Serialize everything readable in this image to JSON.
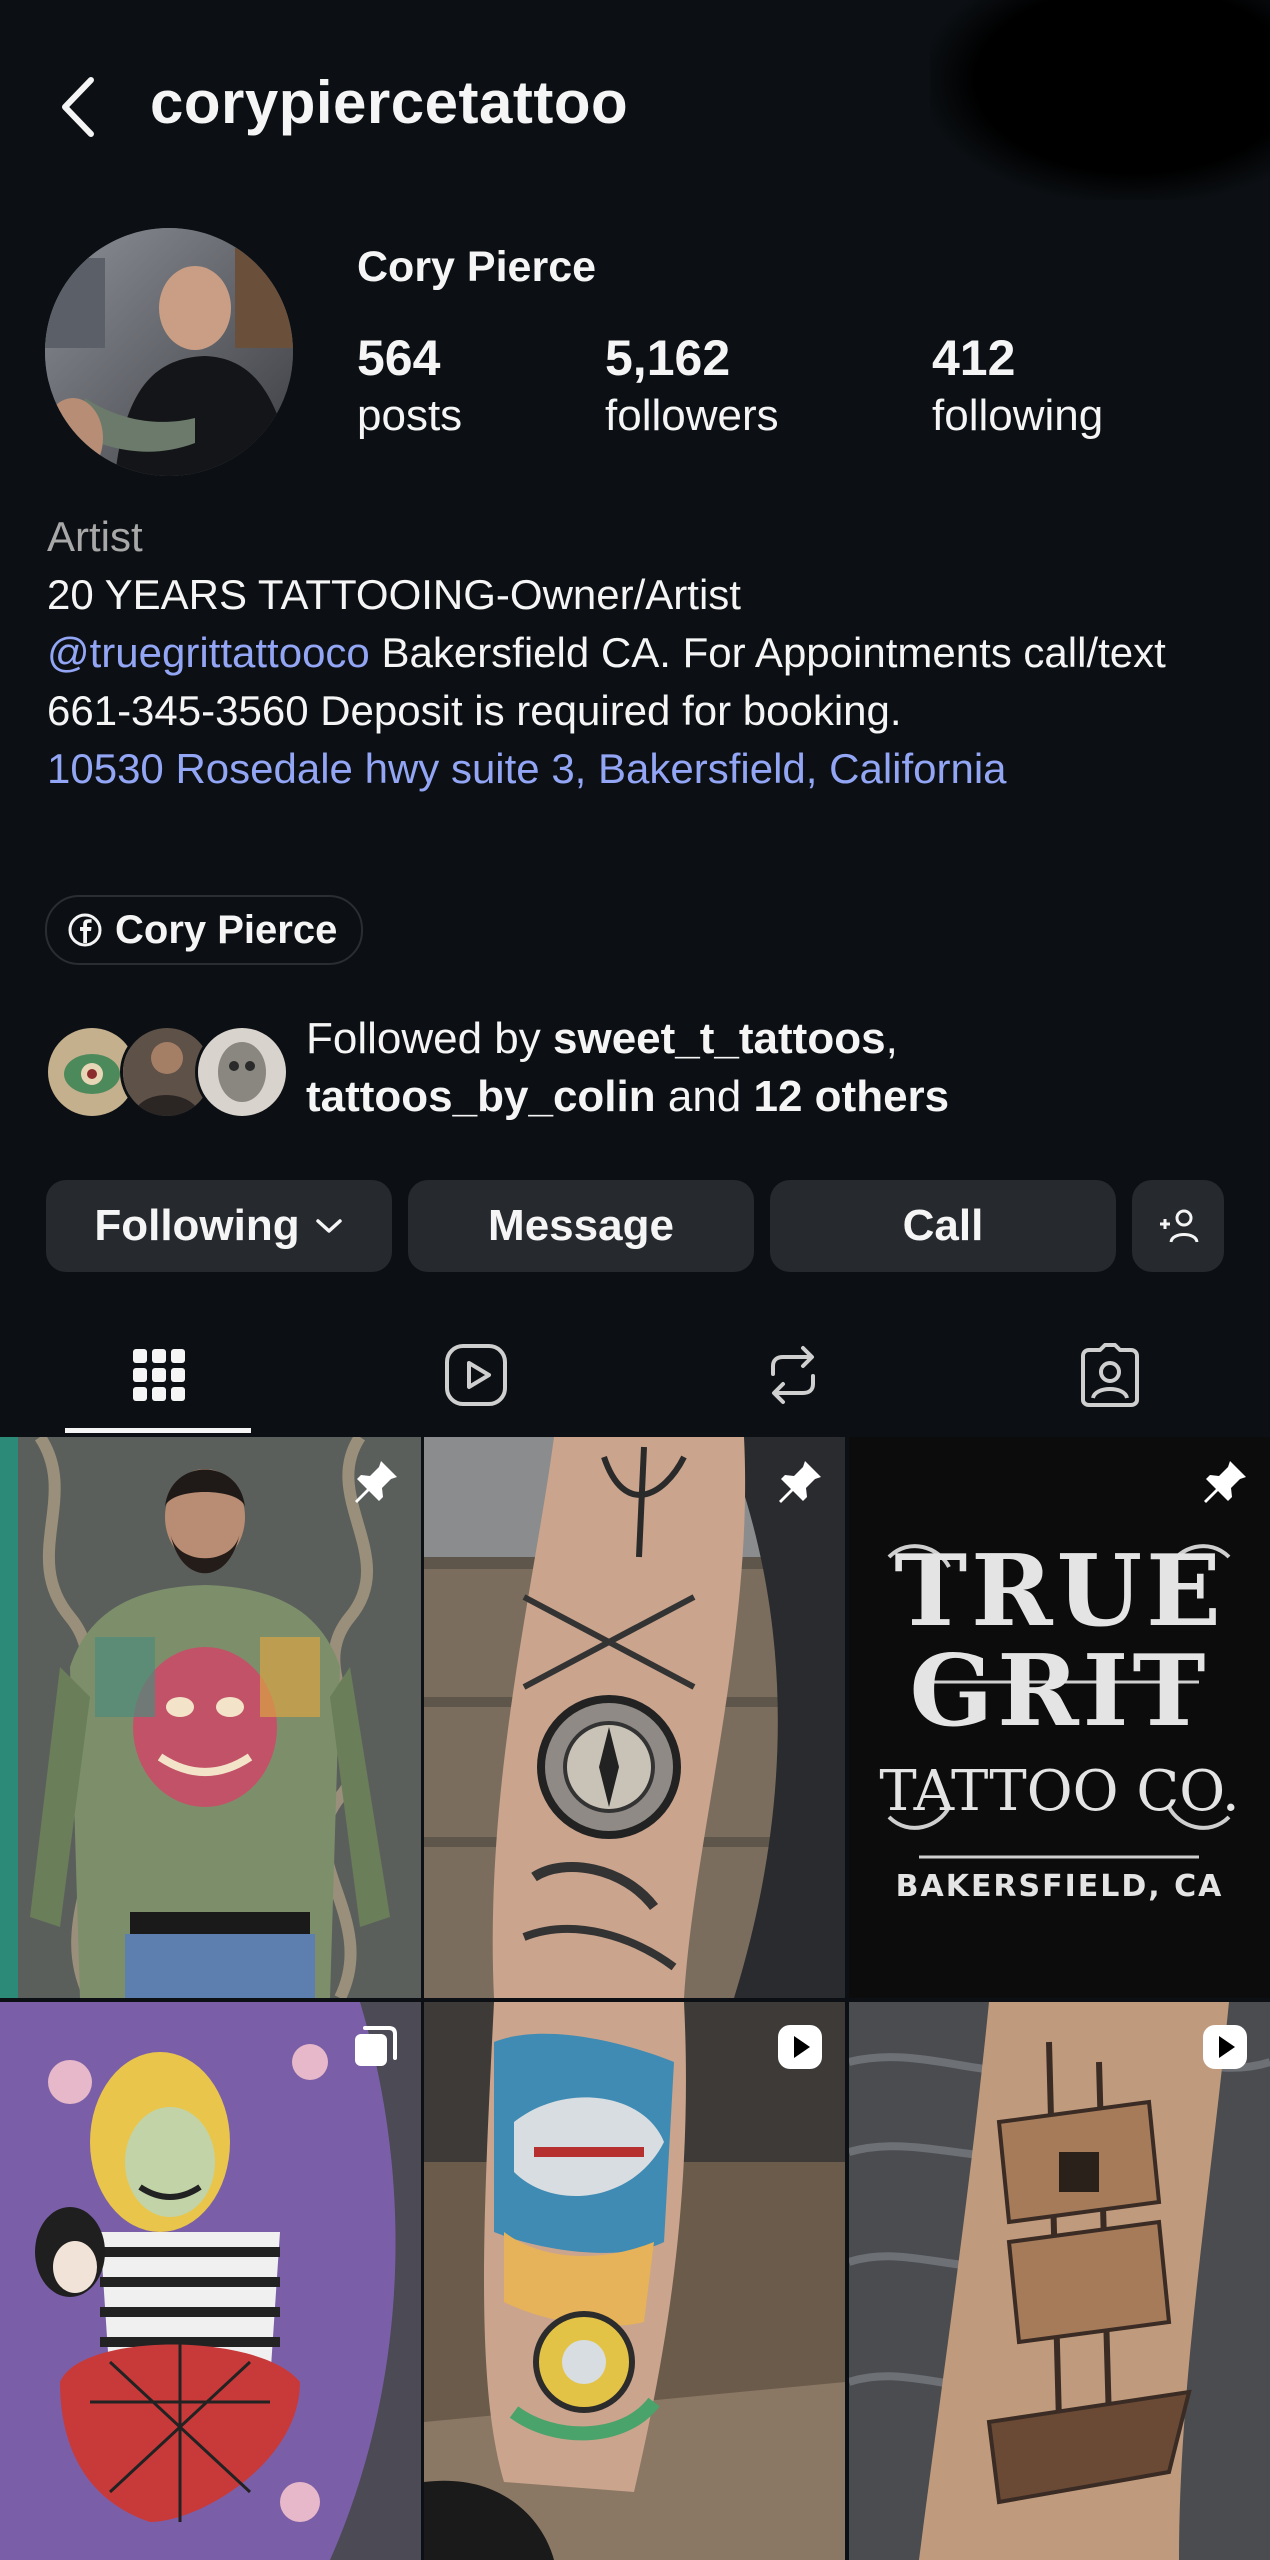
{
  "header": {
    "username": "corypiercetattoo",
    "back_icon": "chevron-left-icon"
  },
  "profile": {
    "display_name": "Cory Pierce",
    "stats": [
      {
        "value": "564",
        "label": "posts"
      },
      {
        "value": "5,162",
        "label": "followers"
      },
      {
        "value": "412",
        "label": "following"
      }
    ],
    "category": "Artist",
    "bio": {
      "line1": "20 YEARS TATTOOING-Owner/Artist",
      "mention": "@truegrittattooco",
      "text": " Bakersfield CA. For Appointments call/text 661-345-3560 Deposit is required for booking.",
      "address": "10530 Rosedale hwy suite 3, Bakersfield, California"
    },
    "facebook_link": "Cory Pierce",
    "followed_by": {
      "prefix": "Followed by ",
      "user1": "sweet_t_tattoos",
      "separator": ", ",
      "user2": "tattoos_by_colin",
      "middle": " and ",
      "others": "12 others"
    }
  },
  "actions": {
    "following": "Following",
    "message": "Message",
    "call": "Call",
    "add_user_icon": "add-person-icon"
  },
  "tabs": [
    {
      "name": "posts-grid",
      "icon": "grid-icon",
      "active": true
    },
    {
      "name": "reels",
      "icon": "reels-play-icon",
      "active": false
    },
    {
      "name": "reposts",
      "icon": "repost-icon",
      "active": false
    },
    {
      "name": "tagged",
      "icon": "tagged-person-icon",
      "active": false
    }
  ],
  "grid": [
    {
      "badge": "pin-icon",
      "subject": "tattooed torso"
    },
    {
      "badge": "pin-icon",
      "subject": "forearm compass tattoo"
    },
    {
      "badge": "pin-icon",
      "subject": "shop logo"
    },
    {
      "badge": "carousel-icon",
      "subject": "beetlejuice tattoo"
    },
    {
      "badge": "video-icon",
      "subject": "shark leg tattoo"
    },
    {
      "badge": "video-icon",
      "subject": "ship tattoo"
    }
  ],
  "logo": {
    "line1": "TRUE",
    "line2": "GRIT",
    "line3": "TATTOO CO.",
    "line4": "BAKERSFIELD, CA"
  },
  "colors": {
    "background": "#0c1014",
    "button": "#262a2f",
    "link": "#93a5f5",
    "muted": "#a8a8a8"
  }
}
